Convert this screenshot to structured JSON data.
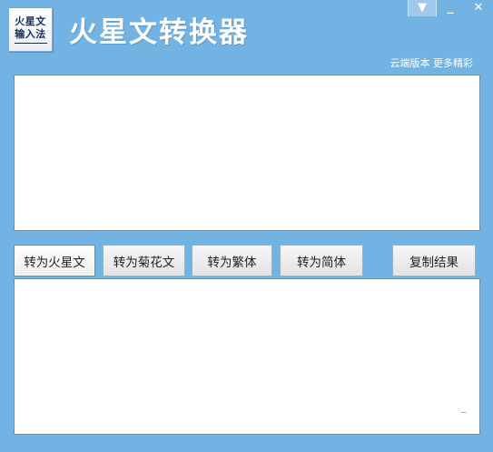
{
  "logo": {
    "line1": "火星文",
    "line2": "输入法"
  },
  "window": {
    "title": "火星文转换器"
  },
  "controls": {
    "menu_glyph": "▼",
    "minimize_glyph": "_",
    "close_glyph": "✕"
  },
  "header": {
    "cloud_link": "云端版本 更多精彩"
  },
  "input": {
    "placeholder": ""
  },
  "output": {
    "value": ""
  },
  "buttons": {
    "to_martian": "转为火星文",
    "to_chrysanthemum": "转为菊花文",
    "to_traditional": "转为繁体",
    "to_simplified": "转为简体",
    "copy_result": "复制结果"
  }
}
